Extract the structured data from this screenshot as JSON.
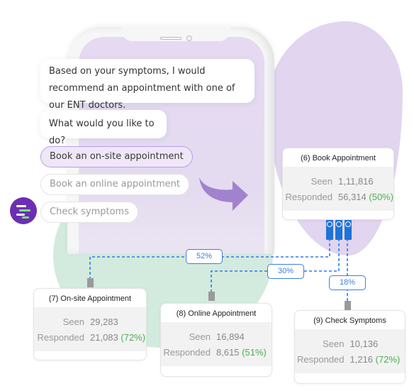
{
  "chat": {
    "bot_message": "Based on your symptoms, I would recommend an appointment with one of our ENT doctors.",
    "question": "What would you like to do?",
    "options": [
      {
        "label": "Book an on-site appointment",
        "selected": true
      },
      {
        "label": "Book an online appointment",
        "selected": false
      },
      {
        "label": "Check symptoms",
        "selected": false
      }
    ],
    "bot_avatar_icon": "bot-logo-icon"
  },
  "flow": {
    "source": {
      "title": "(6) Book Appointment",
      "seen_label": "Seen",
      "seen": "1,11,816",
      "responded_label": "Responded",
      "responded": "56,314",
      "responded_pct": "(50%)"
    },
    "branches": [
      {
        "share": "52%",
        "title": "(7) On-site Appointment",
        "seen_label": "Seen",
        "seen": "29,283",
        "responded_label": "Responded",
        "responded": "21,083",
        "responded_pct": "(72%)"
      },
      {
        "share": "30%",
        "title": "(8) Online Appointment",
        "seen_label": "Seen",
        "seen": "16,894",
        "responded_label": "Responded",
        "responded": "8,615",
        "responded_pct": "(51%)"
      },
      {
        "share": "18%",
        "title": "(9) Check Symptoms",
        "seen_label": "Seen",
        "seen": "10,136",
        "responded_label": "Responded",
        "responded": "1,216",
        "responded_pct": "(72%)"
      }
    ]
  },
  "colors": {
    "accent_purple": "#6b2fb3",
    "connector_blue": "#1e73d8",
    "pct_green": "#4caf50"
  }
}
